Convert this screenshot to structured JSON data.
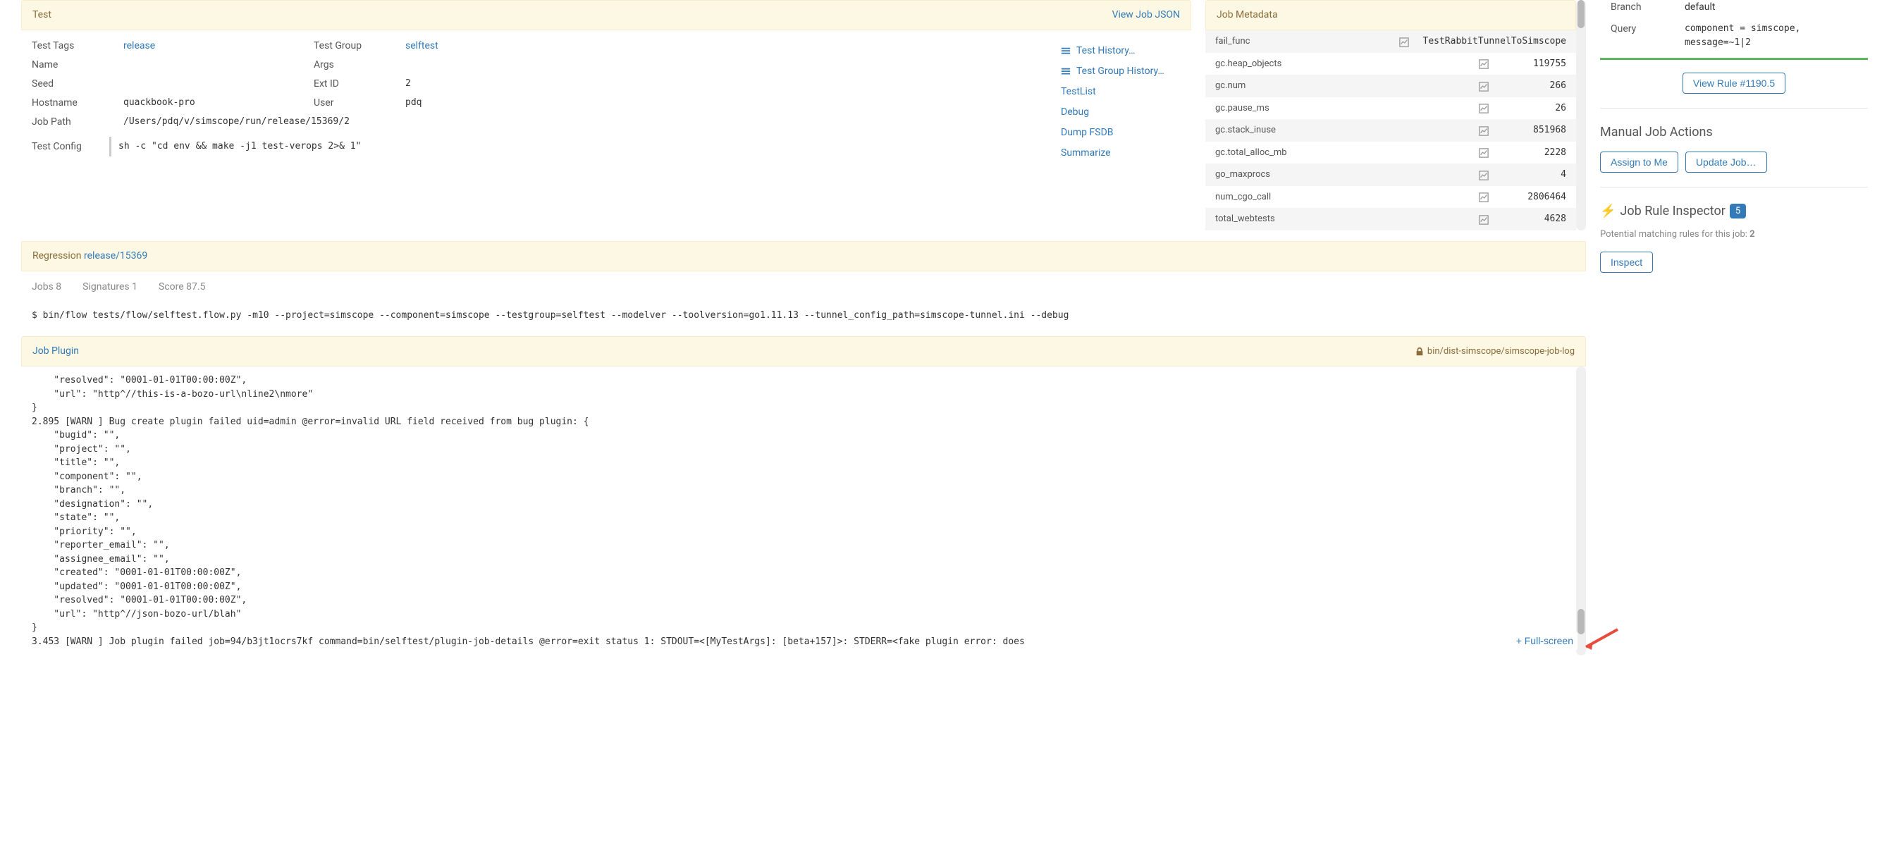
{
  "test": {
    "header_title": "Test",
    "view_json_label": "View Job JSON",
    "labels": {
      "test_tags": "Test Tags",
      "test_group": "Test Group",
      "name": "Name",
      "args": "Args",
      "seed": "Seed",
      "ext_id": "Ext ID",
      "hostname": "Hostname",
      "user": "User",
      "job_path": "Job Path",
      "test_config": "Test Config"
    },
    "values": {
      "test_tags": "release",
      "test_group": "selftest",
      "name": "",
      "args": "",
      "seed": "",
      "ext_id": "2",
      "hostname": "quackbook-pro",
      "user": "pdq",
      "job_path": "/Users/pdq/v/simscope/run/release/15369/2",
      "test_config": "sh -c \"cd env && make -j1 test-verops 2>& 1\""
    },
    "actions": {
      "test_history": "Test History…",
      "test_group_history": "Test Group History…",
      "testlist": "TestList",
      "debug": "Debug",
      "dump_fsdb": "Dump FSDB",
      "summarize": "Summarize"
    }
  },
  "metadata": {
    "header_title": "Job Metadata",
    "rows": [
      {
        "key": "fail_func",
        "value": "TestRabbitTunnelToSimscope"
      },
      {
        "key": "gc.heap_objects",
        "value": "119755"
      },
      {
        "key": "gc.num",
        "value": "266"
      },
      {
        "key": "gc.pause_ms",
        "value": "26"
      },
      {
        "key": "gc.stack_inuse",
        "value": "851968"
      },
      {
        "key": "gc.total_alloc_mb",
        "value": "2228"
      },
      {
        "key": "go_maxprocs",
        "value": "4"
      },
      {
        "key": "num_cgo_call",
        "value": "2806464"
      },
      {
        "key": "total_webtests",
        "value": "4628"
      }
    ]
  },
  "regression": {
    "header_prefix": "Regression ",
    "header_link": "release/15369",
    "stats": {
      "jobs_label": "Jobs",
      "jobs": "8",
      "signatures_label": "Signatures",
      "signatures": "1",
      "score_label": "Score",
      "score": "87.5"
    },
    "command": "$ bin/flow tests/flow/selftest.flow.py -m10 --project=simscope --component=simscope --testgroup=selftest --modelver --toolversion=go1.11.13 --tunnel_config_path=simscope-tunnel.ini --debug"
  },
  "plugin": {
    "header_link": "Job Plugin",
    "path": "bin/dist-simscope/simscope-job-log",
    "full_screen_label": "+ Full-screen",
    "log": "    \"resolved\": \"0001-01-01T00:00:00Z\",\n    \"url\": \"http^//this-is-a-bozo-url\\nline2\\nmore\"\n}\n2.895 [WARN ] Bug create plugin failed uid=admin @error=invalid URL field received from bug plugin: {\n    \"bugid\": \"\",\n    \"project\": \"\",\n    \"title\": \"\",\n    \"component\": \"\",\n    \"branch\": \"\",\n    \"designation\": \"\",\n    \"state\": \"\",\n    \"priority\": \"\",\n    \"reporter_email\": \"\",\n    \"assignee_email\": \"\",\n    \"created\": \"0001-01-01T00:00:00Z\",\n    \"updated\": \"0001-01-01T00:00:00Z\",\n    \"resolved\": \"0001-01-01T00:00:00Z\",\n    \"url\": \"http^//json-bozo-url/blah\"\n}\n3.453 [WARN ] Job plugin failed job=94/b3jt1ocrs7kf command=bin/selftest/plugin-job-details @error=exit status 1: STDOUT=<[MyTestArgs]: [beta+157]>: STDERR=<fake plugin error: does"
  },
  "rule": {
    "branch_label": "Branch",
    "branch": "default",
    "query_label": "Query",
    "query": "component = simscope,\nmessage=~1|2",
    "view_rule_label": "View Rule #1190.5"
  },
  "manual": {
    "title": "Manual Job Actions",
    "assign_label": "Assign to Me",
    "update_label": "Update Job…"
  },
  "inspector": {
    "title": "Job Rule Inspector",
    "badge": "5",
    "potential": "Potential matching rules for this job: ",
    "potential_count": "2",
    "inspect_label": "Inspect"
  }
}
